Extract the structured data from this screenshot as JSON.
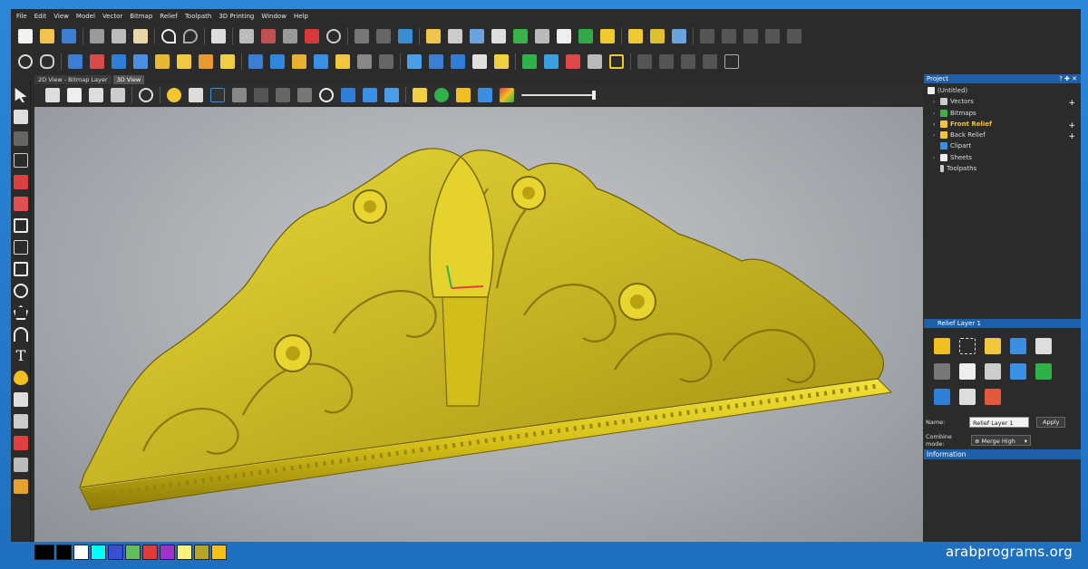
{
  "menu": [
    "File",
    "Edit",
    "View",
    "Model",
    "Vector",
    "Bitmap",
    "Relief",
    "Toolpath",
    "3D Printing",
    "Window",
    "Help"
  ],
  "tabs": [
    {
      "label": "2D View - Bitmap Layer"
    },
    {
      "label": "3D View"
    }
  ],
  "project": {
    "title": "Project",
    "header_controls": "? ✚ ✕",
    "items": [
      {
        "label": "(Untitled)",
        "bold": false
      },
      {
        "label": "Vectors",
        "bold": false
      },
      {
        "label": "Bitmaps",
        "bold": false
      },
      {
        "label": "Front Relief",
        "bold": true
      },
      {
        "label": "Back Relief",
        "bold": false
      },
      {
        "label": "Clipart",
        "bold": false
      },
      {
        "label": "Sheets",
        "bold": false
      },
      {
        "label": "Toolpaths",
        "bold": false
      }
    ]
  },
  "relief_panel": {
    "title": "Relief Layer 1",
    "name_label": "Name:",
    "name_value": "Relief Layer 1",
    "apply_label": "Apply",
    "combine_label": "Combine mode:",
    "combine_value": "Merge High"
  },
  "information_label": "Information",
  "watermark": "arabprograms.org",
  "palette_colors": [
    "#000000",
    "#ffffff",
    "#00ffff",
    "#3a4fd0",
    "#5fbf5a",
    "#e03a3a",
    "#a030d0",
    "#fff27a",
    "#b5a62a",
    "#f5c11a"
  ],
  "colors": {
    "accent": "#1f5fa8",
    "relief_gold": "#d8c21a"
  }
}
